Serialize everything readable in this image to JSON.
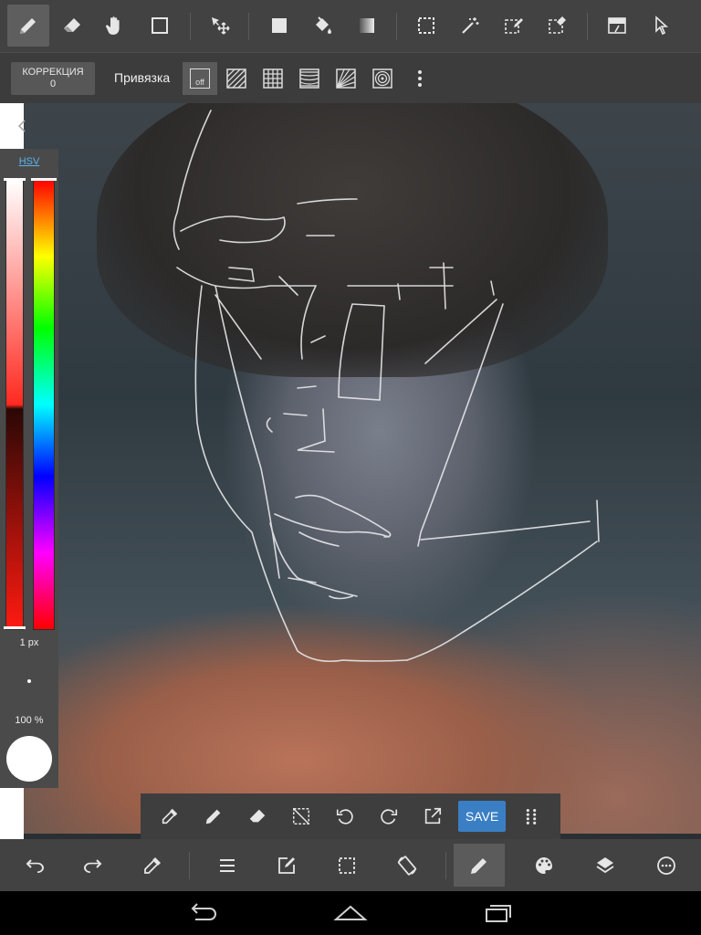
{
  "top_toolbar": {
    "tools": [
      "pen-tool",
      "eraser-tool",
      "hand-tool",
      "rectangle-tool",
      "move-tool",
      "fill-rect-tool",
      "bucket-tool",
      "gradient-tool",
      "select-rect-tool",
      "magic-wand-tool",
      "select-pen-tool",
      "select-eraser-tool",
      "layer-effect-tool",
      "pointer-tool"
    ],
    "active_tool": "pen-tool"
  },
  "sub_toolbar": {
    "correction_label": "КОРРЕКЦИЯ",
    "correction_value": "0",
    "snap_label": "Привязка",
    "snap_off_label": "off",
    "snap_modes": [
      "off",
      "parallel",
      "grid",
      "perspective",
      "radial",
      "concentric"
    ]
  },
  "color_panel": {
    "mode_label": "HSV",
    "brush_size": "1 px",
    "opacity": "100 %",
    "current_color": "#ffffff"
  },
  "float_toolbar": {
    "save_label": "SAVE"
  },
  "accent_color": "#3a7fc4"
}
